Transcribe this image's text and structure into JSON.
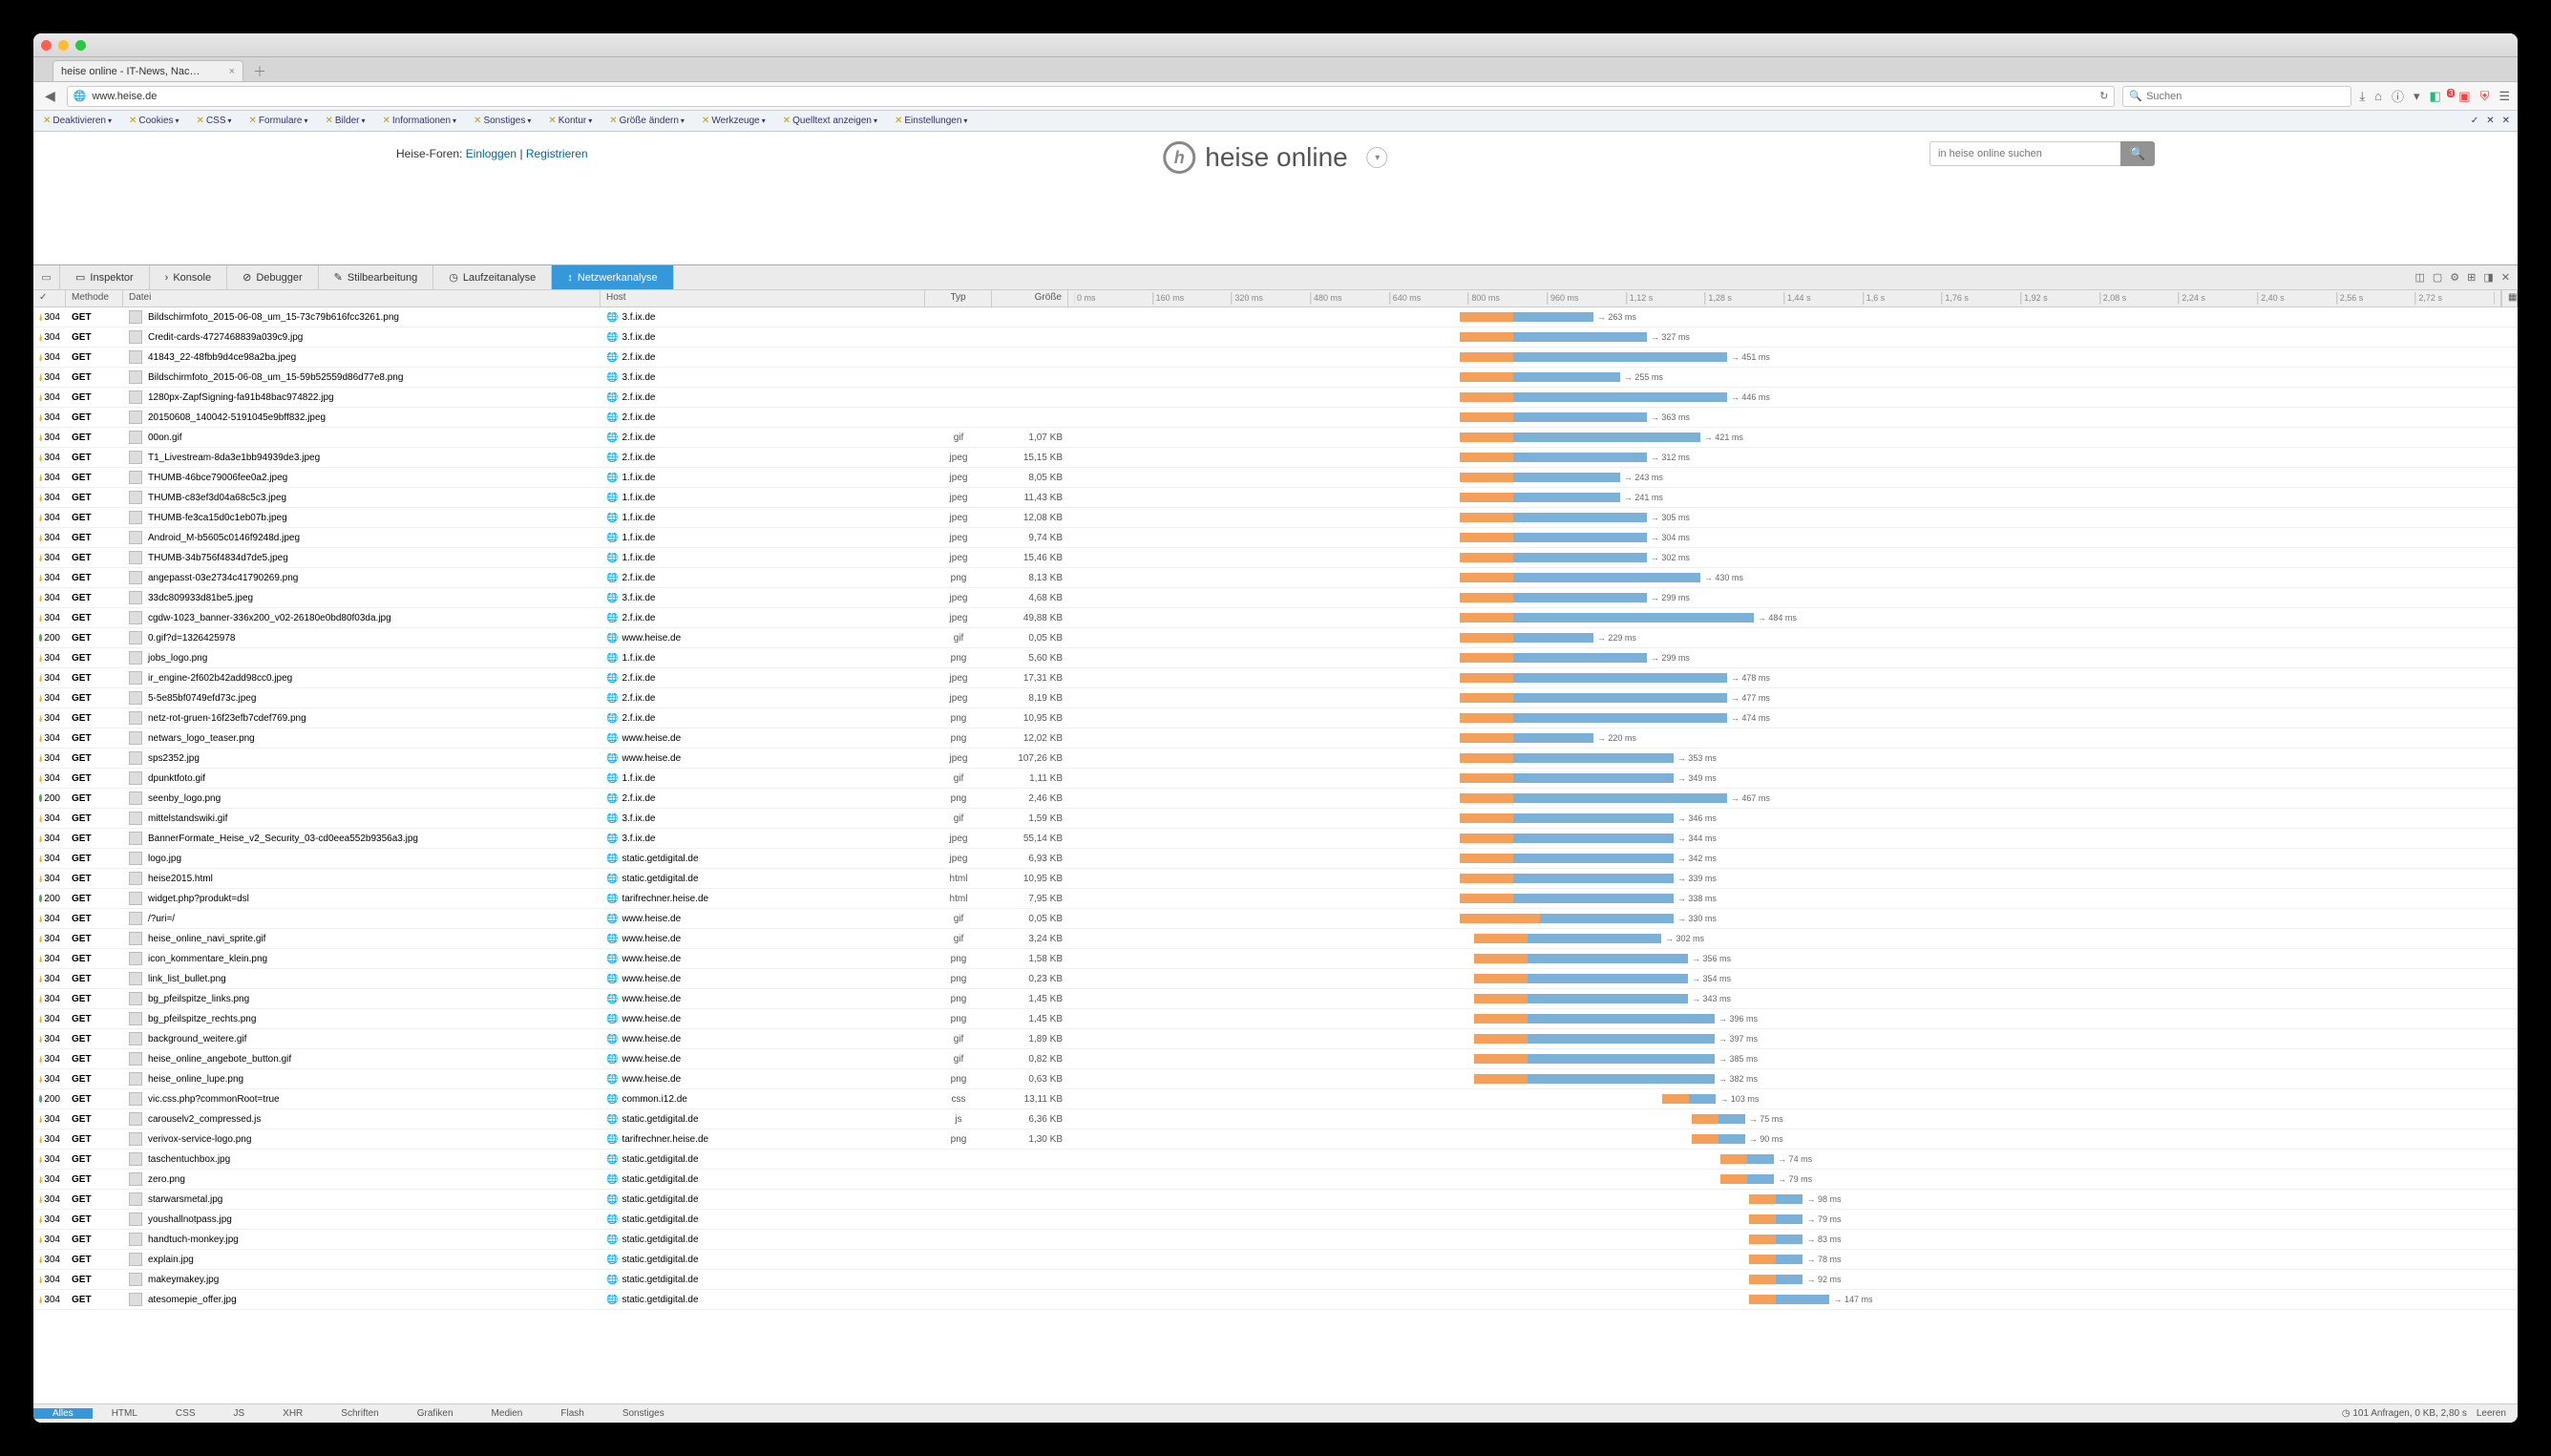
{
  "browser_tab": {
    "title": "heise online - IT-News, Nac…"
  },
  "url": "www.heise.de",
  "search_placeholder": "Suchen",
  "page": {
    "forum_prefix": "Heise-Foren: ",
    "login": "Einloggen",
    "register": "Registrieren",
    "brand": "heise online",
    "page_search_placeholder": "in heise online suchen"
  },
  "wdtoolbar": [
    "Deaktivieren",
    "Cookies",
    "CSS",
    "Formulare",
    "Bilder",
    "Informationen",
    "Sonstiges",
    "Kontur",
    "Größe ändern",
    "Werkzeuge",
    "Quelltext anzeigen",
    "Einstellungen"
  ],
  "devtabs": {
    "inspector": "Inspektor",
    "console": "Konsole",
    "debugger": "Debugger",
    "style": "Stilbearbeitung",
    "perf": "Laufzeitanalyse",
    "network": "Netzwerkanalyse"
  },
  "columns": {
    "status": "✓",
    "method": "Methode",
    "file": "Datei",
    "host": "Host",
    "type": "Typ",
    "size": "Größe"
  },
  "timeline_ticks": [
    "0 ms",
    "160 ms",
    "320 ms",
    "480 ms",
    "640 ms",
    "800 ms",
    "960 ms",
    "1,12 s",
    "1,28 s",
    "1,44 s",
    "1,6 s",
    "1,76 s",
    "1,92 s",
    "2,08 s",
    "2,24 s",
    "2,40 s",
    "2,56 s",
    "2,72 s"
  ],
  "filters": [
    "Alles",
    "HTML",
    "CSS",
    "JS",
    "XHR",
    "Schriften",
    "Grafiken",
    "Medien",
    "Flash",
    "Sonstiges"
  ],
  "summary": {
    "text": "101 Anfragen, 0 KB, 2,80 s",
    "clear": "Leeren"
  },
  "requests": [
    {
      "s": 304,
      "m": "GET",
      "f": "Bildschirmfoto_2015-06-08_um_15-73c79b616fcc3261.png",
      "h": "3.f.ix.de",
      "t": "",
      "z": "",
      "b": [
        27,
        2,
        3
      ],
      "l": "→ 263 ms"
    },
    {
      "s": 304,
      "m": "GET",
      "f": "Credit-cards-4727468839a039c9.jpg",
      "h": "3.f.ix.de",
      "t": "",
      "z": "",
      "b": [
        27,
        2,
        5
      ],
      "l": "→ 327 ms"
    },
    {
      "s": 304,
      "m": "GET",
      "f": "41843_22-48fbb9d4ce98a2ba.jpeg",
      "h": "2.f.ix.de",
      "t": "",
      "z": "",
      "b": [
        27,
        2,
        8
      ],
      "l": "→ 451 ms"
    },
    {
      "s": 304,
      "m": "GET",
      "f": "Bildschirmfoto_2015-06-08_um_15-59b52559d86d77e8.png",
      "h": "3.f.ix.de",
      "t": "",
      "z": "",
      "b": [
        27,
        2,
        4
      ],
      "l": "→ 255 ms"
    },
    {
      "s": 304,
      "m": "GET",
      "f": "1280px-ZapfSigning-fa91b48bac974822.jpg",
      "h": "2.f.ix.de",
      "t": "",
      "z": "",
      "b": [
        27,
        2,
        8
      ],
      "l": "→ 446 ms"
    },
    {
      "s": 304,
      "m": "GET",
      "f": "20150608_140042-5191045e9bff832.jpeg",
      "h": "2.f.ix.de",
      "t": "",
      "z": "",
      "b": [
        27,
        2,
        5
      ],
      "l": "→ 363 ms"
    },
    {
      "s": 304,
      "m": "GET",
      "f": "00on.gif",
      "h": "2.f.ix.de",
      "t": "gif",
      "z": "1,07 KB",
      "b": [
        27,
        2,
        7
      ],
      "l": "→ 421 ms"
    },
    {
      "s": 304,
      "m": "GET",
      "f": "T1_Livestream-8da3e1bb94939de3.jpeg",
      "h": "2.f.ix.de",
      "t": "jpeg",
      "z": "15,15 KB",
      "b": [
        27,
        2,
        5
      ],
      "l": "→ 312 ms"
    },
    {
      "s": 304,
      "m": "GET",
      "f": "THUMB-46bce79006fee0a2.jpeg",
      "h": "1.f.ix.de",
      "t": "jpeg",
      "z": "8,05 KB",
      "b": [
        27,
        2,
        4
      ],
      "l": "→ 243 ms"
    },
    {
      "s": 304,
      "m": "GET",
      "f": "THUMB-c83ef3d04a68c5c3.jpeg",
      "h": "1.f.ix.de",
      "t": "jpeg",
      "z": "11,43 KB",
      "b": [
        27,
        2,
        4
      ],
      "l": "→ 241 ms"
    },
    {
      "s": 304,
      "m": "GET",
      "f": "THUMB-fe3ca15d0c1eb07b.jpeg",
      "h": "1.f.ix.de",
      "t": "jpeg",
      "z": "12,08 KB",
      "b": [
        27,
        2,
        5
      ],
      "l": "→ 305 ms"
    },
    {
      "s": 304,
      "m": "GET",
      "f": "Android_M-b5605c0146f9248d.jpeg",
      "h": "1.f.ix.de",
      "t": "jpeg",
      "z": "9,74 KB",
      "b": [
        27,
        2,
        5
      ],
      "l": "→ 304 ms"
    },
    {
      "s": 304,
      "m": "GET",
      "f": "THUMB-34b756f4834d7de5.jpeg",
      "h": "1.f.ix.de",
      "t": "jpeg",
      "z": "15,46 KB",
      "b": [
        27,
        2,
        5
      ],
      "l": "→ 302 ms"
    },
    {
      "s": 304,
      "m": "GET",
      "f": "angepasst-03e2734c41790269.png",
      "h": "2.f.ix.de",
      "t": "png",
      "z": "8,13 KB",
      "b": [
        27,
        2,
        7
      ],
      "l": "→ 430 ms"
    },
    {
      "s": 304,
      "m": "GET",
      "f": "33dc809933d81be5.jpeg",
      "h": "3.f.ix.de",
      "t": "jpeg",
      "z": "4,68 KB",
      "b": [
        27,
        2,
        5
      ],
      "l": "→ 299 ms"
    },
    {
      "s": 304,
      "m": "GET",
      "f": "cgdw-1023_banner-336x200_v02-26180e0bd80f03da.jpg",
      "h": "2.f.ix.de",
      "t": "jpeg",
      "z": "49,88 KB",
      "b": [
        27,
        2,
        9
      ],
      "l": "→ 484 ms"
    },
    {
      "s": 200,
      "m": "GET",
      "f": "0.gif?d=1326425978",
      "h": "www.heise.de",
      "t": "gif",
      "z": "0,05 KB",
      "b": [
        27,
        2,
        3
      ],
      "l": "→ 229 ms"
    },
    {
      "s": 304,
      "m": "GET",
      "f": "jobs_logo.png",
      "h": "1.f.ix.de",
      "t": "png",
      "z": "5,60 KB",
      "b": [
        27,
        2,
        5
      ],
      "l": "→ 299 ms"
    },
    {
      "s": 304,
      "m": "GET",
      "f": "ir_engine-2f602b42add98cc0.jpeg",
      "h": "2.f.ix.de",
      "t": "jpeg",
      "z": "17,31 KB",
      "b": [
        27,
        2,
        8
      ],
      "l": "→ 478 ms"
    },
    {
      "s": 304,
      "m": "GET",
      "f": "5-5e85bf0749efd73c.jpeg",
      "h": "2.f.ix.de",
      "t": "jpeg",
      "z": "8,19 KB",
      "b": [
        27,
        2,
        8
      ],
      "l": "→ 477 ms"
    },
    {
      "s": 304,
      "m": "GET",
      "f": "netz-rot-gruen-16f23efb7cdef769.png",
      "h": "2.f.ix.de",
      "t": "png",
      "z": "10,95 KB",
      "b": [
        27,
        2,
        8
      ],
      "l": "→ 474 ms"
    },
    {
      "s": 304,
      "m": "GET",
      "f": "netwars_logo_teaser.png",
      "h": "www.heise.de",
      "t": "png",
      "z": "12,02 KB",
      "b": [
        27,
        2,
        3
      ],
      "l": "→ 220 ms"
    },
    {
      "s": 304,
      "m": "GET",
      "f": "sps2352.jpg",
      "h": "www.heise.de",
      "t": "jpeg",
      "z": "107,26 KB",
      "b": [
        27,
        2,
        6
      ],
      "l": "→ 353 ms"
    },
    {
      "s": 304,
      "m": "GET",
      "f": "dpunktfoto.gif",
      "h": "1.f.ix.de",
      "t": "gif",
      "z": "1,11 KB",
      "b": [
        27,
        2,
        6
      ],
      "l": "→ 349 ms"
    },
    {
      "s": 200,
      "m": "GET",
      "f": "seenby_logo.png",
      "h": "2.f.ix.de",
      "t": "png",
      "z": "2,46 KB",
      "b": [
        27,
        2,
        8
      ],
      "l": "→ 467 ms"
    },
    {
      "s": 304,
      "m": "GET",
      "f": "mittelstandswiki.gif",
      "h": "3.f.ix.de",
      "t": "gif",
      "z": "1,59 KB",
      "b": [
        27,
        2,
        6
      ],
      "l": "→ 346 ms"
    },
    {
      "s": 304,
      "m": "GET",
      "f": "BannerFormate_Heise_v2_Security_03-cd0eea552b9356a3.jpg",
      "h": "3.f.ix.de",
      "t": "jpeg",
      "z": "55,14 KB",
      "b": [
        27,
        2,
        6
      ],
      "l": "→ 344 ms"
    },
    {
      "s": 304,
      "m": "GET",
      "f": "logo.jpg",
      "h": "static.getdigital.de",
      "t": "jpeg",
      "z": "6,93 KB",
      "b": [
        27,
        2,
        6
      ],
      "l": "→ 342 ms"
    },
    {
      "s": 304,
      "m": "GET",
      "f": "heise2015.html",
      "h": "static.getdigital.de",
      "t": "html",
      "z": "10,95 KB",
      "b": [
        27,
        2,
        6
      ],
      "l": "→ 339 ms"
    },
    {
      "s": 200,
      "m": "GET",
      "f": "widget.php?produkt=dsl",
      "h": "tarifrechner.heise.de",
      "t": "html",
      "z": "7,95 KB",
      "b": [
        27,
        2,
        6
      ],
      "l": "→ 338 ms"
    },
    {
      "s": 304,
      "m": "GET",
      "f": "/?uri=/",
      "h": "www.heise.de",
      "t": "gif",
      "z": "0,05 KB",
      "b": [
        27,
        3,
        5
      ],
      "l": "→ 330 ms"
    },
    {
      "s": 304,
      "m": "GET",
      "f": "heise_online_navi_sprite.gif",
      "h": "www.heise.de",
      "t": "gif",
      "z": "3,24 KB",
      "b": [
        28,
        2,
        5
      ],
      "l": "→ 302 ms"
    },
    {
      "s": 304,
      "m": "GET",
      "f": "icon_kommentare_klein.png",
      "h": "www.heise.de",
      "t": "png",
      "z": "1,58 KB",
      "b": [
        28,
        2,
        6
      ],
      "l": "→ 356 ms"
    },
    {
      "s": 304,
      "m": "GET",
      "f": "link_list_bullet.png",
      "h": "www.heise.de",
      "t": "png",
      "z": "0,23 KB",
      "b": [
        28,
        2,
        6
      ],
      "l": "→ 354 ms"
    },
    {
      "s": 304,
      "m": "GET",
      "f": "bg_pfeilspitze_links.png",
      "h": "www.heise.de",
      "t": "png",
      "z": "1,45 KB",
      "b": [
        28,
        2,
        6
      ],
      "l": "→ 343 ms"
    },
    {
      "s": 304,
      "m": "GET",
      "f": "bg_pfeilspitze_rechts.png",
      "h": "www.heise.de",
      "t": "png",
      "z": "1,45 KB",
      "b": [
        28,
        2,
        7
      ],
      "l": "→ 396 ms"
    },
    {
      "s": 304,
      "m": "GET",
      "f": "background_weitere.gif",
      "h": "www.heise.de",
      "t": "gif",
      "z": "1,89 KB",
      "b": [
        28,
        2,
        7
      ],
      "l": "→ 397 ms"
    },
    {
      "s": 304,
      "m": "GET",
      "f": "heise_online_angebote_button.gif",
      "h": "www.heise.de",
      "t": "gif",
      "z": "0,82 KB",
      "b": [
        28,
        2,
        7
      ],
      "l": "→ 385 ms"
    },
    {
      "s": 304,
      "m": "GET",
      "f": "heise_online_lupe.png",
      "h": "www.heise.de",
      "t": "png",
      "z": "0,63 KB",
      "b": [
        28,
        2,
        7
      ],
      "l": "→ 382 ms"
    },
    {
      "s": 200,
      "m": "GET",
      "f": "vic.css.php?commonRoot=true",
      "h": "common.i12.de",
      "t": "css",
      "z": "13,11 KB",
      "b": [
        41,
        1,
        1
      ],
      "l": "→ 103 ms"
    },
    {
      "s": 304,
      "m": "GET",
      "f": "carouselv2_compressed.js",
      "h": "static.getdigital.de",
      "t": "js",
      "z": "6,36 KB",
      "b": [
        43,
        1,
        1
      ],
      "l": "→ 75 ms"
    },
    {
      "s": 304,
      "m": "GET",
      "f": "verivox-service-logo.png",
      "h": "tarifrechner.heise.de",
      "t": "png",
      "z": "1,30 KB",
      "b": [
        43,
        1,
        1
      ],
      "l": "→ 90 ms"
    },
    {
      "s": 304,
      "m": "GET",
      "f": "taschentuchbox.jpg",
      "h": "static.getdigital.de",
      "t": "",
      "z": "",
      "b": [
        45,
        1,
        1
      ],
      "l": "→ 74 ms"
    },
    {
      "s": 304,
      "m": "GET",
      "f": "zero.png",
      "h": "static.getdigital.de",
      "t": "",
      "z": "",
      "b": [
        45,
        1,
        1
      ],
      "l": "→ 79 ms"
    },
    {
      "s": 304,
      "m": "GET",
      "f": "starwarsmetal.jpg",
      "h": "static.getdigital.de",
      "t": "",
      "z": "",
      "b": [
        47,
        1,
        1
      ],
      "l": "→ 98 ms"
    },
    {
      "s": 304,
      "m": "GET",
      "f": "youshallnotpass.jpg",
      "h": "static.getdigital.de",
      "t": "",
      "z": "",
      "b": [
        47,
        1,
        1
      ],
      "l": "→ 79 ms"
    },
    {
      "s": 304,
      "m": "GET",
      "f": "handtuch-monkey.jpg",
      "h": "static.getdigital.de",
      "t": "",
      "z": "",
      "b": [
        47,
        1,
        1
      ],
      "l": "→ 83 ms"
    },
    {
      "s": 304,
      "m": "GET",
      "f": "explain.jpg",
      "h": "static.getdigital.de",
      "t": "",
      "z": "",
      "b": [
        47,
        1,
        1
      ],
      "l": "→ 78 ms"
    },
    {
      "s": 304,
      "m": "GET",
      "f": "makeymakey.jpg",
      "h": "static.getdigital.de",
      "t": "",
      "z": "",
      "b": [
        47,
        1,
        1
      ],
      "l": "→ 92 ms"
    },
    {
      "s": 304,
      "m": "GET",
      "f": "atesomepie_offer.jpg",
      "h": "static.getdigital.de",
      "t": "",
      "z": "",
      "b": [
        47,
        1,
        2
      ],
      "l": "→ 147 ms"
    }
  ]
}
